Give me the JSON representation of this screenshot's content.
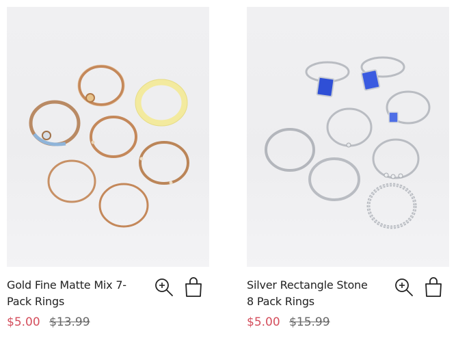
{
  "products": [
    {
      "name": "Gold Fine Matte Mix 7-Pack Rings",
      "price": "$5.00",
      "original_price": "$13.99",
      "image_alt": "Gold Fine Matte Mix 7-Pack Rings"
    },
    {
      "name": "Silver Rectangle Stone 8 Pack Rings",
      "price": "$5.00",
      "original_price": "$15.99",
      "image_alt": "Silver Rectangle Stone 8 Pack Rings"
    }
  ],
  "icons": {
    "quick_view": "zoom-in-icon",
    "add_to_bag": "shopping-bag-icon"
  },
  "colors": {
    "sale_price": "#d44e5c",
    "original_price": "#666666",
    "text": "#222222",
    "gold_ring": "#c4885a",
    "silver_ring": "#b9bcc2",
    "blue_stone": "#2f4fd6",
    "yellow_ring": "#f3ea9e"
  }
}
